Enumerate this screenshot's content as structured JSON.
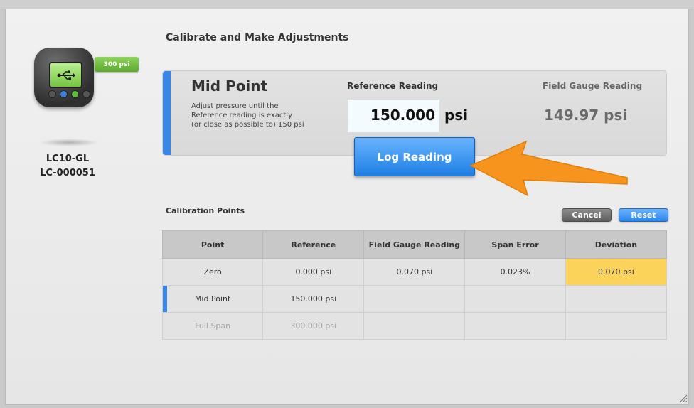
{
  "device": {
    "range_badge": "300 psi",
    "model": "LC10-GL",
    "serial": "LC-000051",
    "screen_icon": "usb-icon"
  },
  "header": {
    "title": "Calibrate and Make Adjustments"
  },
  "step": {
    "title": "Mid Point",
    "instructions": [
      "Adjust pressure until the",
      "Reference reading is exactly",
      "(or close as possible to) 150 psi"
    ],
    "reference_label": "Reference Reading",
    "reference_value": "150.000",
    "reference_unit": "psi",
    "field_label": "Field Gauge Reading",
    "field_value": "149.97 psi",
    "log_button": "Log Reading",
    "accent_color": "#3a86e6"
  },
  "calibration": {
    "title": "Calibration Points",
    "cancel_label": "Cancel",
    "reset_label": "Reset",
    "columns": [
      "Point",
      "Reference",
      "Field Gauge Reading",
      "Span Error",
      "Deviation"
    ],
    "rows": [
      [
        "Zero",
        "0.000 psi",
        "0.070 psi",
        "0.023%",
        "0.070 psi"
      ],
      [
        "Mid Point",
        "150.000 psi",
        "",
        "",
        ""
      ],
      [
        "Full Span",
        "300.000 psi",
        "",
        "",
        ""
      ]
    ],
    "highlight_color": "#fbd35b"
  },
  "annotation": {
    "arrow_color": "#f7941d",
    "arrow_icon": "pointer-arrow-icon"
  }
}
